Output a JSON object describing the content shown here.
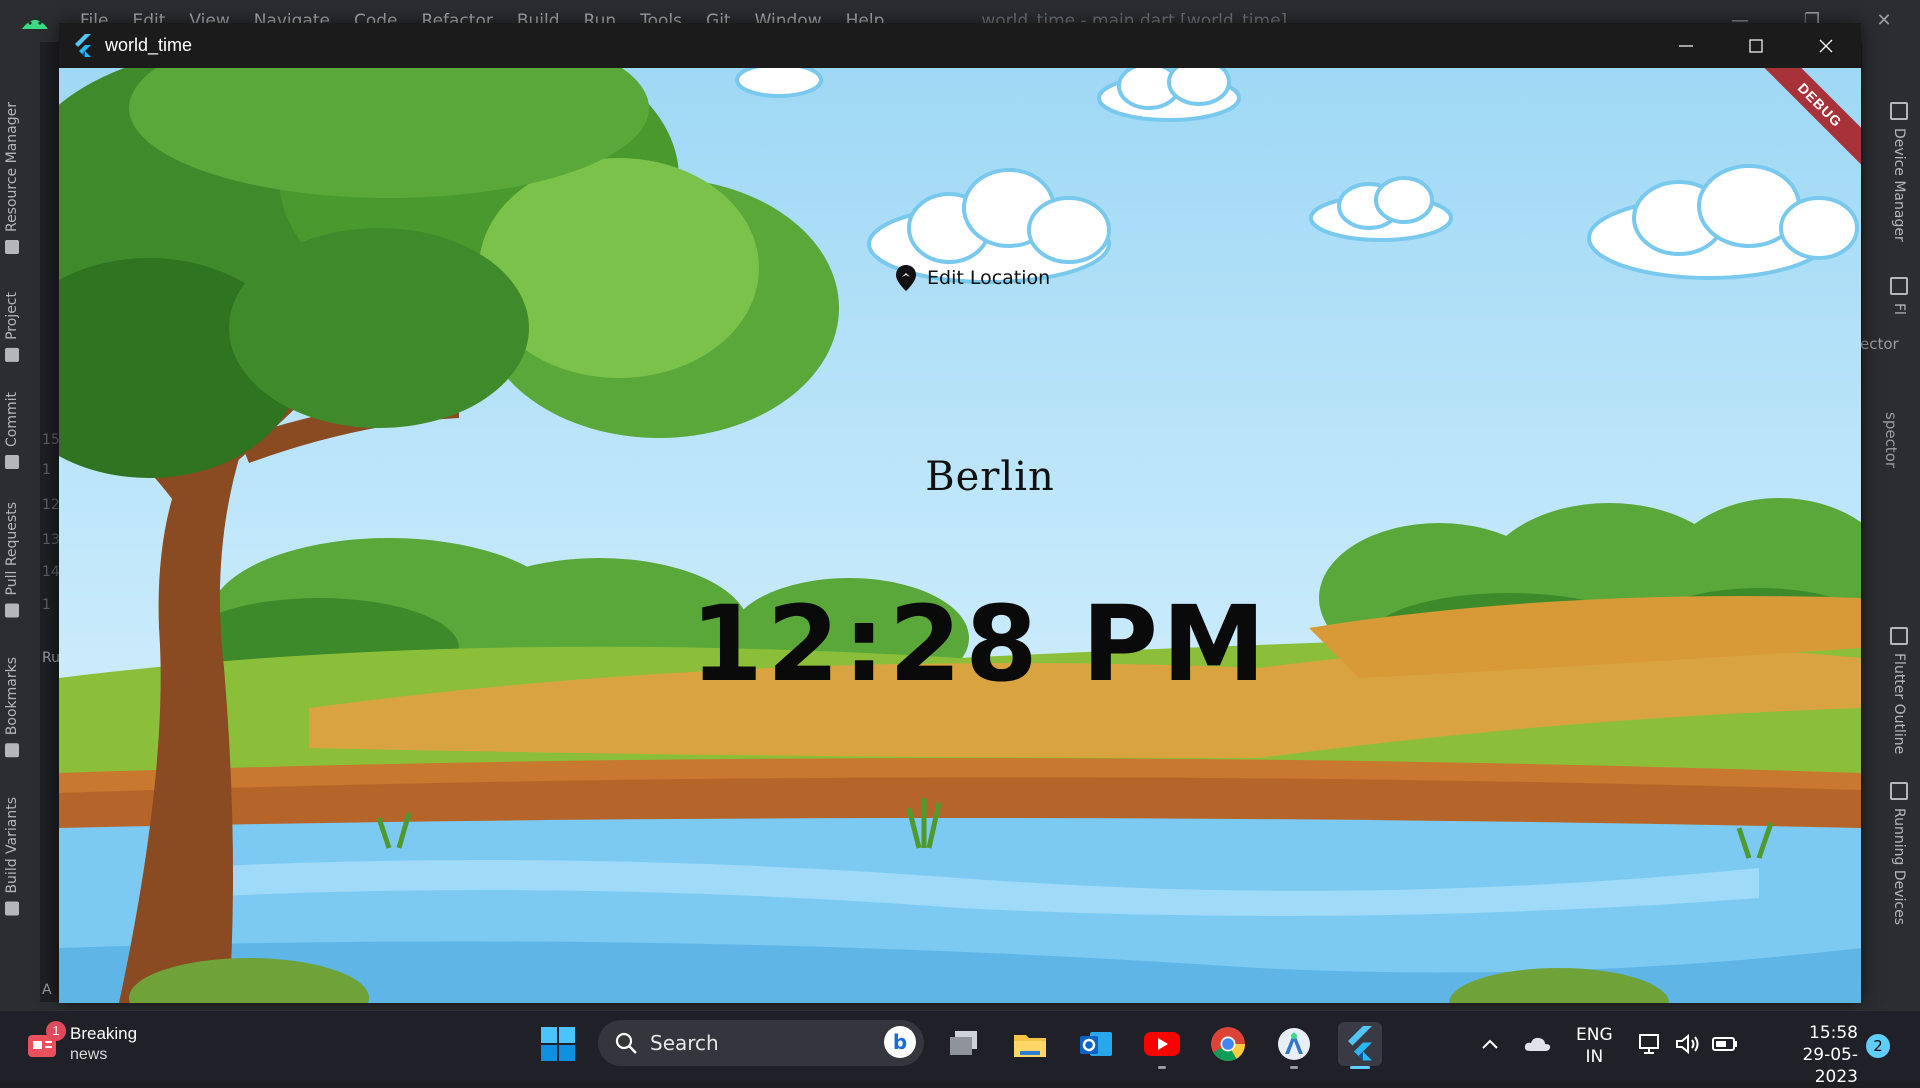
{
  "ide": {
    "menu": [
      "File",
      "Edit",
      "View",
      "Navigate",
      "Code",
      "Refactor",
      "Build",
      "Run",
      "Tools",
      "Git",
      "Window",
      "Help"
    ],
    "title": "world_time - main.dart [world_time]",
    "left_tabs": [
      "Resource Manager",
      "Project",
      "Commit",
      "Pull Requests",
      "Bookmarks",
      "Build Variants"
    ],
    "right_tabs": [
      "Device Manager",
      "Fl",
      "Flutter Outline",
      "Running Devices"
    ],
    "partial_texts": [
      "ector",
      "spector",
      "Ru",
      "A"
    ],
    "line_numbers": [
      "15",
      "1",
      "12",
      "13",
      "14",
      "1"
    ]
  },
  "app": {
    "window_title": "world_time",
    "edit_location_label": "Edit Location",
    "location": "Berlin",
    "time": "12:28 PM",
    "debug_banner": "DEBUG"
  },
  "taskbar": {
    "news_title": "Breaking",
    "news_subtitle": "news",
    "news_badge": "1",
    "search_label": "Search",
    "bing_glyph": "b",
    "lang_top": "ENG",
    "lang_bottom": "IN",
    "time": "15:58",
    "date": "29-05-2023",
    "notification_count": "2",
    "apps": [
      "file-explorer-icon",
      "files-icon",
      "outlook-icon",
      "youtube-icon",
      "chrome-icon",
      "android-studio-icon",
      "flutter-icon"
    ]
  },
  "colors": {
    "sky_top": "#9fd8f5",
    "debug_banner": "#a7323a",
    "accent": "#60cdff"
  }
}
